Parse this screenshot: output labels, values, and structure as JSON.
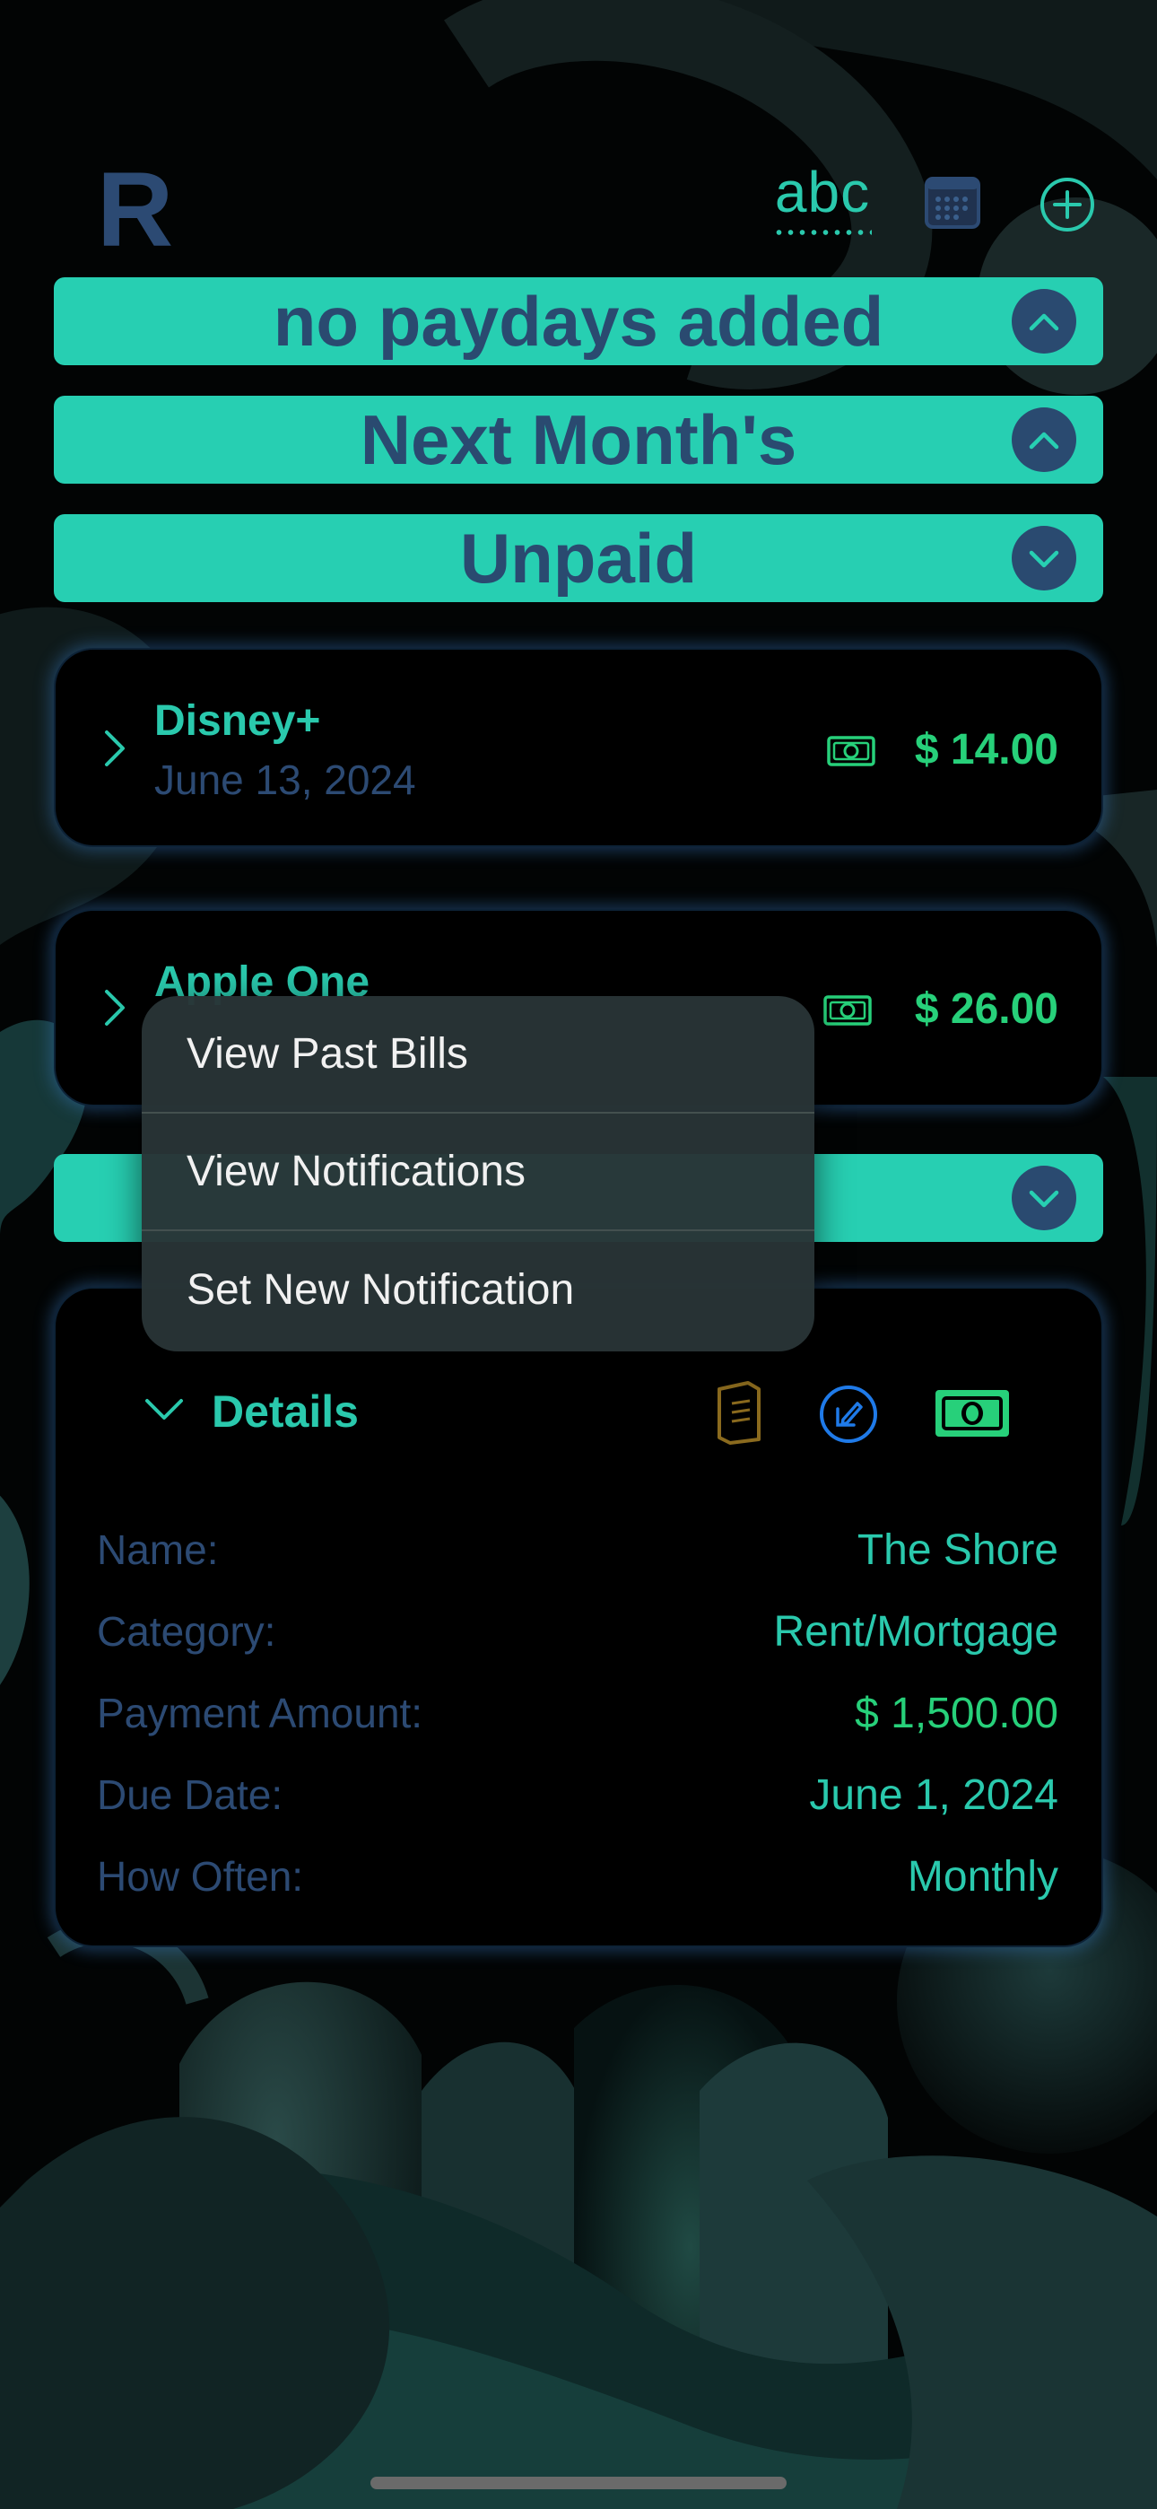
{
  "header": {
    "logo": "R",
    "sort_label": "abc",
    "calendar_icon": "calendar-icon",
    "add_icon": "plus-circle-icon"
  },
  "banners": {
    "paydays": "no paydays added",
    "next_month": "Next Month's",
    "unpaid": "Unpaid"
  },
  "bills": [
    {
      "name": "Disney+",
      "date": "June 13, 2024",
      "amount": "$ 14.00"
    },
    {
      "name": "Apple One",
      "amount": "$ 26.00"
    }
  ],
  "context_menu": {
    "items": [
      "View Past Bills",
      "View Notifications",
      "Set New Notification"
    ]
  },
  "details": {
    "title": "Details",
    "rows": [
      {
        "label": "Name:",
        "value": "The Shore"
      },
      {
        "label": "Category:",
        "value": "Rent/Mortgage"
      },
      {
        "label": "Payment Amount:",
        "value": "$ 1,500.00"
      },
      {
        "label": "Due Date:",
        "value": "June 1, 2024"
      },
      {
        "label": "How Often:",
        "value": "Monthly"
      }
    ]
  },
  "colors": {
    "accent": "#27cfb2",
    "navy": "#2a4a70",
    "money_green": "#27d07a",
    "edit_blue": "#1f7ae8",
    "notes_gold": "#8a6a1e"
  }
}
